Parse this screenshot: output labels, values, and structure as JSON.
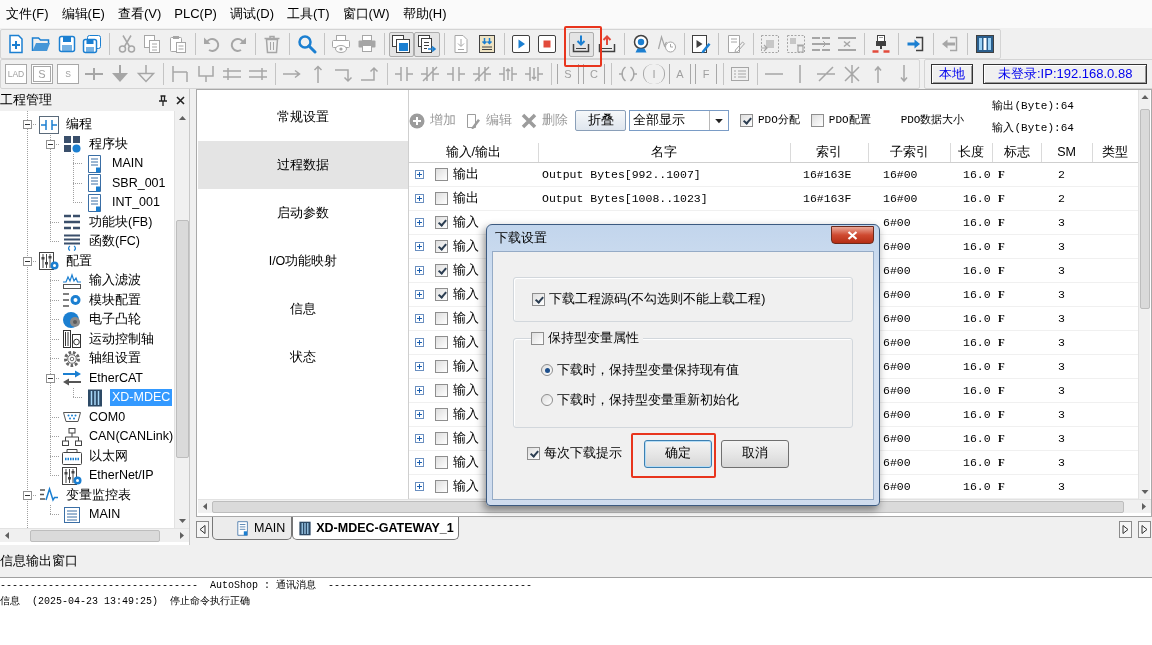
{
  "menu": [
    "文件(F)",
    "编辑(E)",
    "查看(V)",
    "PLC(P)",
    "调试(D)",
    "工具(T)",
    "窗口(W)",
    "帮助(H)"
  ],
  "toolbar_1": [
    [
      {
        "kind": "new",
        "disabled": false,
        "pressed": false
      },
      {
        "kind": "open",
        "disabled": false,
        "pressed": false
      },
      {
        "kind": "save",
        "disabled": false,
        "pressed": false
      },
      {
        "kind": "save_all",
        "disabled": false,
        "pressed": false
      }
    ],
    [
      {
        "kind": "cut",
        "disabled": true,
        "pressed": false
      },
      {
        "kind": "copy",
        "disabled": true,
        "pressed": false
      },
      {
        "kind": "paste",
        "disabled": true,
        "pressed": false
      }
    ],
    [
      {
        "kind": "undo",
        "disabled": true,
        "pressed": false
      },
      {
        "kind": "redo",
        "disabled": true,
        "pressed": false
      }
    ],
    [
      {
        "kind": "delete",
        "disabled": true,
        "pressed": false
      }
    ],
    [
      {
        "kind": "search",
        "disabled": false,
        "pressed": false
      }
    ],
    [
      {
        "kind": "print_preview",
        "disabled": true,
        "pressed": false
      },
      {
        "kind": "print",
        "disabled": true,
        "pressed": false
      }
    ],
    [
      {
        "kind": "cascade",
        "disabled": false,
        "pressed": true
      },
      {
        "kind": "export",
        "disabled": false,
        "pressed": true
      }
    ],
    [
      {
        "kind": "doc_download",
        "disabled": true,
        "pressed": false
      },
      {
        "kind": "doc_compile",
        "disabled": false,
        "pressed": false
      }
    ],
    [
      {
        "kind": "run",
        "disabled": false,
        "pressed": false
      },
      {
        "kind": "stop",
        "disabled": false,
        "pressed": false
      }
    ],
    [
      {
        "kind": "download",
        "disabled": false,
        "pressed": true,
        "highlighted": true
      },
      {
        "kind": "upload",
        "disabled": false,
        "pressed": false
      }
    ],
    [
      {
        "kind": "monitor",
        "disabled": false,
        "pressed": false
      },
      {
        "kind": "trend",
        "disabled": true,
        "pressed": false
      }
    ],
    [
      {
        "kind": "edit_run",
        "disabled": false,
        "pressed": false
      }
    ],
    [
      {
        "kind": "edit",
        "disabled": true,
        "pressed": false
      }
    ],
    [
      {
        "kind": "grid",
        "disabled": true,
        "pressed": false
      },
      {
        "kind": "grid_delete",
        "disabled": true,
        "pressed": false
      },
      {
        "kind": "align",
        "disabled": true,
        "pressed": false
      },
      {
        "kind": "align_x",
        "disabled": true,
        "pressed": false
      }
    ],
    [
      {
        "kind": "test",
        "disabled": false,
        "pressed": false
      }
    ],
    [
      {
        "kind": "login",
        "disabled": false,
        "pressed": false
      }
    ],
    [
      {
        "kind": "logout",
        "disabled": true,
        "pressed": false
      }
    ],
    [
      {
        "kind": "panel",
        "disabled": false,
        "pressed": false
      }
    ]
  ],
  "toolbar_2": [
    [
      {
        "kind": "box",
        "glyph": "LAD",
        "disabled": true
      },
      {
        "kind": "box2",
        "glyph": "S",
        "disabled": true
      },
      {
        "kind": "box",
        "glyph": "S",
        "disabled": true
      },
      {
        "kind": "rung_cross",
        "disabled": true
      },
      {
        "kind": "arrow_down_filled",
        "disabled": true
      },
      {
        "kind": "arrow_down_outline",
        "disabled": true
      }
    ],
    [
      {
        "kind": "branch_open",
        "disabled": true
      },
      {
        "kind": "branch_close",
        "disabled": true
      },
      {
        "kind": "branch_down",
        "disabled": true
      },
      {
        "kind": "branch_up",
        "disabled": true
      }
    ],
    [
      {
        "kind": "line_right",
        "disabled": true
      },
      {
        "kind": "line_up",
        "disabled": true
      },
      {
        "kind": "corner_down",
        "disabled": true
      },
      {
        "kind": "corner_up",
        "disabled": true
      }
    ],
    [
      {
        "kind": "contact",
        "disabled": true
      },
      {
        "kind": "contact_nc",
        "disabled": true
      },
      {
        "kind": "contact",
        "disabled": true
      },
      {
        "kind": "contact_nc",
        "disabled": true
      },
      {
        "kind": "contact_rise",
        "disabled": true
      },
      {
        "kind": "contact_fall",
        "disabled": true
      }
    ],
    [
      {
        "kind": "bracket",
        "glyph": "S",
        "disabled": true
      },
      {
        "kind": "bracket",
        "glyph": "C",
        "disabled": true
      }
    ],
    [
      {
        "kind": "coil",
        "disabled": true
      },
      {
        "kind": "coil",
        "glyph": "I",
        "disabled": true
      },
      {
        "kind": "bracket",
        "glyph": "A",
        "disabled": true
      },
      {
        "kind": "bracket",
        "glyph": "F",
        "disabled": true
      }
    ],
    [
      {
        "kind": "list",
        "disabled": true
      }
    ],
    [
      {
        "kind": "hline",
        "disabled": true
      },
      {
        "kind": "vline",
        "disabled": true
      },
      {
        "kind": "slash",
        "disabled": true
      },
      {
        "kind": "cross_x",
        "disabled": true
      },
      {
        "kind": "arrow_up",
        "disabled": true
      },
      {
        "kind": "arrow_down",
        "disabled": true
      }
    ]
  ],
  "connection": {
    "mode": "本地",
    "status": "未登录:IP:192.168.0.88"
  },
  "project_panel": {
    "title": "工程管理",
    "tree": [
      {
        "label": "编程",
        "kind": "ladder",
        "expanded": true,
        "selected": false,
        "children": [
          {
            "label": "程序块",
            "kind": "blocks",
            "expanded": true,
            "selected": false,
            "children": [
              {
                "label": "MAIN",
                "kind": "program",
                "selected": false
              },
              {
                "label": "SBR_001",
                "kind": "program",
                "selected": false
              },
              {
                "label": "INT_001",
                "kind": "program",
                "selected": false
              }
            ]
          },
          {
            "label": "功能块(FB)",
            "kind": "fb",
            "selected": false
          },
          {
            "label": "函数(FC)",
            "kind": "fc",
            "selected": false
          }
        ]
      },
      {
        "label": "配置",
        "kind": "config",
        "expanded": true,
        "selected": false,
        "children": [
          {
            "label": "输入滤波",
            "kind": "filter",
            "selected": false
          },
          {
            "label": "模块配置",
            "kind": "module",
            "selected": false
          },
          {
            "label": "电子凸轮",
            "kind": "cam",
            "selected": false
          },
          {
            "label": "运动控制轴",
            "kind": "axis",
            "selected": false
          },
          {
            "label": "轴组设置",
            "kind": "gear",
            "selected": false
          },
          {
            "label": "EtherCAT",
            "kind": "ethercat",
            "expanded": true,
            "selected": false,
            "children": [
              {
                "label": "XD-MDEC",
                "kind": "device",
                "selected": true
              }
            ]
          },
          {
            "label": "COM0",
            "kind": "serial",
            "selected": false
          },
          {
            "label": "CAN(CANLink)",
            "kind": "network",
            "selected": false
          },
          {
            "label": "以太网",
            "kind": "ethernet",
            "selected": false
          },
          {
            "label": "EtherNet/IP",
            "kind": "config",
            "selected": false
          }
        ]
      },
      {
        "label": "变量监控表",
        "kind": "watch",
        "expanded": true,
        "selected": false,
        "children": [
          {
            "label": "MAIN",
            "kind": "table",
            "selected": false
          }
        ]
      }
    ]
  },
  "editor": {
    "nav": [
      {
        "label": "常规设置",
        "selected": false
      },
      {
        "label": "过程数据",
        "selected": true
      },
      {
        "label": "启动参数",
        "selected": false
      },
      {
        "label": "I/O功能映射",
        "selected": false
      },
      {
        "label": "信息",
        "selected": false
      },
      {
        "label": "状态",
        "selected": false
      }
    ],
    "actions": [
      {
        "kind": "add",
        "label": "增加",
        "disabled": true
      },
      {
        "kind": "edit",
        "label": "编辑",
        "disabled": true
      },
      {
        "kind": "delete",
        "label": "删除",
        "disabled": true
      }
    ],
    "collapse_button": "折叠",
    "filter": {
      "value": "全部显示"
    },
    "pdo_assign": {
      "label": "PDO分配",
      "checked": true
    },
    "pdo_config": {
      "label": "PDO配置",
      "checked": false
    },
    "pdo_size_label": "PDO数据大小",
    "output_size": "输出(Byte):64",
    "input_size": "输入(Byte):64",
    "table": {
      "columns": [
        "输入/输出",
        "名字",
        "索引",
        "子索引",
        "长度",
        "标志",
        "SM",
        "类型"
      ],
      "rows": [
        {
          "io": "输出",
          "expanded": false,
          "checked": false,
          "name": "Output Bytes[992..1007]",
          "index": "16#163E",
          "sub_index": "16#00",
          "length": "16.0",
          "flag": "F",
          "sm": "2"
        },
        {
          "io": "输出",
          "expanded": false,
          "checked": false,
          "name": "Output Bytes[1008..1023]",
          "index": "16#163F",
          "sub_index": "16#00",
          "length": "16.0",
          "flag": "F",
          "sm": "2"
        },
        {
          "io": "输入",
          "expanded": false,
          "checked": true,
          "sub_index": "6#00",
          "length": "16.0",
          "flag": "F",
          "sm": "3"
        },
        {
          "io": "输入",
          "expanded": false,
          "checked": true,
          "sub_index": "6#00",
          "length": "16.0",
          "flag": "F",
          "sm": "3"
        },
        {
          "io": "输入",
          "expanded": false,
          "checked": true,
          "sub_index": "6#00",
          "length": "16.0",
          "flag": "F",
          "sm": "3"
        },
        {
          "io": "输入",
          "expanded": false,
          "checked": true,
          "sub_index": "6#00",
          "length": "16.0",
          "flag": "F",
          "sm": "3"
        },
        {
          "io": "输入",
          "expanded": false,
          "checked": false,
          "sub_index": "6#00",
          "length": "16.0",
          "flag": "F",
          "sm": "3"
        },
        {
          "io": "输入",
          "expanded": false,
          "checked": false,
          "sub_index": "6#00",
          "length": "16.0",
          "flag": "F",
          "sm": "3"
        },
        {
          "io": "输入",
          "expanded": false,
          "checked": false,
          "sub_index": "6#00",
          "length": "16.0",
          "flag": "F",
          "sm": "3"
        },
        {
          "io": "输入",
          "expanded": false,
          "checked": false,
          "sub_index": "6#00",
          "length": "16.0",
          "flag": "F",
          "sm": "3"
        },
        {
          "io": "输入",
          "expanded": false,
          "checked": false,
          "sub_index": "6#00",
          "length": "16.0",
          "flag": "F",
          "sm": "3"
        },
        {
          "io": "输入",
          "expanded": false,
          "checked": false,
          "sub_index": "6#00",
          "length": "16.0",
          "flag": "F",
          "sm": "3"
        },
        {
          "io": "输入",
          "expanded": false,
          "checked": false,
          "sub_index": "6#00",
          "length": "16.0",
          "flag": "F",
          "sm": "3"
        },
        {
          "io": "输入",
          "expanded": false,
          "checked": false,
          "sub_index": "6#00",
          "length": "16.0",
          "flag": "F",
          "sm": "3"
        }
      ]
    }
  },
  "tabs": [
    {
      "label": "MAIN",
      "kind": "program",
      "selected": false
    },
    {
      "label": "XD-MDEC-GATEWAY_1",
      "kind": "device",
      "selected": true
    }
  ],
  "output_window": {
    "title": "信息输出窗口",
    "lines": [
      "---------------------------------  AutoShop : 通讯消息  ----------------------------------",
      "信息  (2025-04-23 13:49:25)  停止命令执行正确"
    ]
  },
  "dialog": {
    "title": "下载设置",
    "download_source": {
      "label": "下载工程源码(不勾选则不能上载工程)",
      "checked": true
    },
    "retain_group": {
      "label": "保持型变量属性",
      "checked": false,
      "options": [
        {
          "label": "下载时，保持型变量保持现有值",
          "selected": true
        },
        {
          "label": "下载时，保持型变量重新初始化",
          "selected": false
        }
      ]
    },
    "prompt_each": {
      "label": "每次下载提示",
      "checked": true
    },
    "buttons": [
      {
        "label": "确定",
        "focused": true,
        "highlighted": true
      },
      {
        "label": "取消",
        "focused": false
      }
    ]
  }
}
